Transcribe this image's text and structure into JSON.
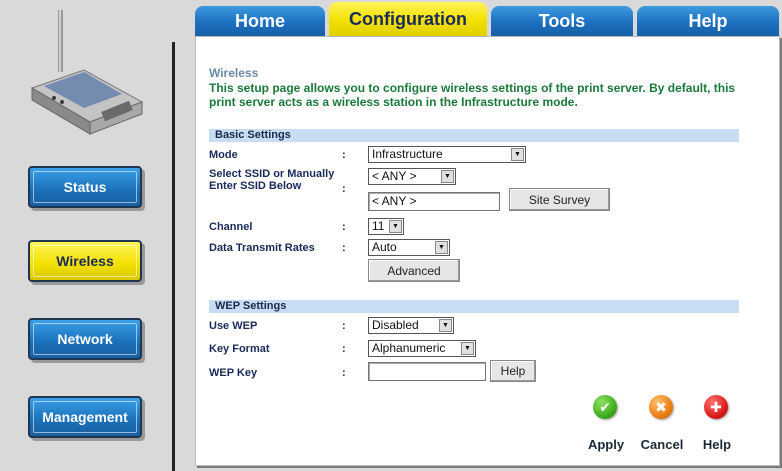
{
  "tabs": [
    {
      "label": "Home",
      "active": false
    },
    {
      "label": "Configuration",
      "active": true
    },
    {
      "label": "Tools",
      "active": false
    },
    {
      "label": "Help",
      "active": false
    }
  ],
  "sidebar": {
    "items": [
      {
        "label": "Status",
        "active": false
      },
      {
        "label": "Wireless",
        "active": true
      },
      {
        "label": "Network",
        "active": false
      },
      {
        "label": "Management",
        "active": false
      }
    ]
  },
  "page": {
    "heading": "Wireless",
    "intro": "This setup page allows you to configure wireless settings of the print server. By default, this print server acts as a wireless station in the Infrastructure mode."
  },
  "basic": {
    "section_label": "Basic Settings",
    "mode_label": "Mode",
    "mode_value": "Infrastructure",
    "ssid_label_1": "Select SSID or Manually",
    "ssid_label_2": "Enter SSID Below",
    "ssid_select_value": "< ANY >",
    "ssid_input_value": "< ANY >",
    "site_survey_label": "Site Survey",
    "channel_label": "Channel",
    "channel_value": "11",
    "rate_label": "Data Transmit Rates",
    "rate_value": "Auto",
    "advanced_label": "Advanced"
  },
  "wep": {
    "section_label": "WEP Settings",
    "use_wep_label": "Use WEP",
    "use_wep_value": "Disabled",
    "key_format_label": "Key Format",
    "key_format_value": "Alphanumeric",
    "wep_key_label": "WEP Key",
    "wep_key_value": "",
    "help_label": "Help"
  },
  "actions": {
    "apply_label": "Apply",
    "cancel_label": "Cancel",
    "help_label": "Help"
  },
  "colon": ":",
  "colors": {
    "tab_blue": "#1d6fc0",
    "tab_active": "#f2e000",
    "heading": "#6a8aa8",
    "intro_text": "#1a7a3a",
    "section_bar": "#c8dcf4",
    "apply_icon": "#3aaa1a",
    "cancel_icon": "#e87a10",
    "help_icon": "#d81818"
  }
}
